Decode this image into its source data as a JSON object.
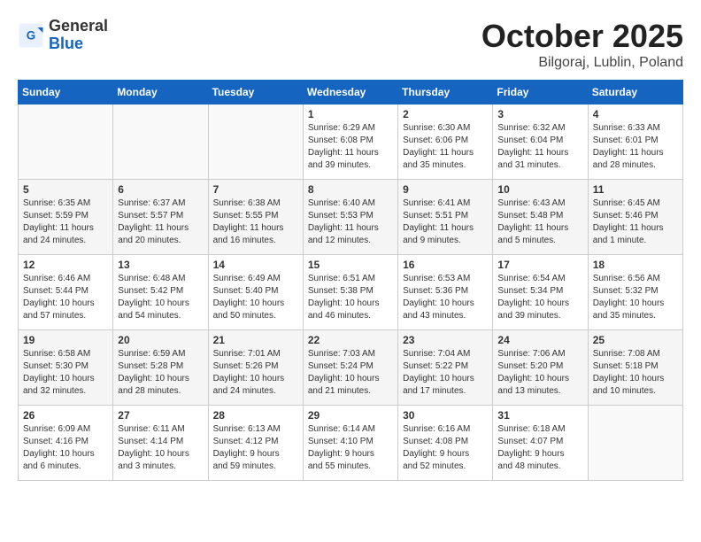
{
  "header": {
    "logo": {
      "general": "General",
      "blue": "Blue"
    },
    "title": "October 2025",
    "location": "Bilgoraj, Lublin, Poland"
  },
  "calendar": {
    "days_of_week": [
      "Sunday",
      "Monday",
      "Tuesday",
      "Wednesday",
      "Thursday",
      "Friday",
      "Saturday"
    ],
    "weeks": [
      [
        {
          "day": "",
          "info": ""
        },
        {
          "day": "",
          "info": ""
        },
        {
          "day": "",
          "info": ""
        },
        {
          "day": "1",
          "info": "Sunrise: 6:29 AM\nSunset: 6:08 PM\nDaylight: 11 hours\nand 39 minutes."
        },
        {
          "day": "2",
          "info": "Sunrise: 6:30 AM\nSunset: 6:06 PM\nDaylight: 11 hours\nand 35 minutes."
        },
        {
          "day": "3",
          "info": "Sunrise: 6:32 AM\nSunset: 6:04 PM\nDaylight: 11 hours\nand 31 minutes."
        },
        {
          "day": "4",
          "info": "Sunrise: 6:33 AM\nSunset: 6:01 PM\nDaylight: 11 hours\nand 28 minutes."
        }
      ],
      [
        {
          "day": "5",
          "info": "Sunrise: 6:35 AM\nSunset: 5:59 PM\nDaylight: 11 hours\nand 24 minutes."
        },
        {
          "day": "6",
          "info": "Sunrise: 6:37 AM\nSunset: 5:57 PM\nDaylight: 11 hours\nand 20 minutes."
        },
        {
          "day": "7",
          "info": "Sunrise: 6:38 AM\nSunset: 5:55 PM\nDaylight: 11 hours\nand 16 minutes."
        },
        {
          "day": "8",
          "info": "Sunrise: 6:40 AM\nSunset: 5:53 PM\nDaylight: 11 hours\nand 12 minutes."
        },
        {
          "day": "9",
          "info": "Sunrise: 6:41 AM\nSunset: 5:51 PM\nDaylight: 11 hours\nand 9 minutes."
        },
        {
          "day": "10",
          "info": "Sunrise: 6:43 AM\nSunset: 5:48 PM\nDaylight: 11 hours\nand 5 minutes."
        },
        {
          "day": "11",
          "info": "Sunrise: 6:45 AM\nSunset: 5:46 PM\nDaylight: 11 hours\nand 1 minute."
        }
      ],
      [
        {
          "day": "12",
          "info": "Sunrise: 6:46 AM\nSunset: 5:44 PM\nDaylight: 10 hours\nand 57 minutes."
        },
        {
          "day": "13",
          "info": "Sunrise: 6:48 AM\nSunset: 5:42 PM\nDaylight: 10 hours\nand 54 minutes."
        },
        {
          "day": "14",
          "info": "Sunrise: 6:49 AM\nSunset: 5:40 PM\nDaylight: 10 hours\nand 50 minutes."
        },
        {
          "day": "15",
          "info": "Sunrise: 6:51 AM\nSunset: 5:38 PM\nDaylight: 10 hours\nand 46 minutes."
        },
        {
          "day": "16",
          "info": "Sunrise: 6:53 AM\nSunset: 5:36 PM\nDaylight: 10 hours\nand 43 minutes."
        },
        {
          "day": "17",
          "info": "Sunrise: 6:54 AM\nSunset: 5:34 PM\nDaylight: 10 hours\nand 39 minutes."
        },
        {
          "day": "18",
          "info": "Sunrise: 6:56 AM\nSunset: 5:32 PM\nDaylight: 10 hours\nand 35 minutes."
        }
      ],
      [
        {
          "day": "19",
          "info": "Sunrise: 6:58 AM\nSunset: 5:30 PM\nDaylight: 10 hours\nand 32 minutes."
        },
        {
          "day": "20",
          "info": "Sunrise: 6:59 AM\nSunset: 5:28 PM\nDaylight: 10 hours\nand 28 minutes."
        },
        {
          "day": "21",
          "info": "Sunrise: 7:01 AM\nSunset: 5:26 PM\nDaylight: 10 hours\nand 24 minutes."
        },
        {
          "day": "22",
          "info": "Sunrise: 7:03 AM\nSunset: 5:24 PM\nDaylight: 10 hours\nand 21 minutes."
        },
        {
          "day": "23",
          "info": "Sunrise: 7:04 AM\nSunset: 5:22 PM\nDaylight: 10 hours\nand 17 minutes."
        },
        {
          "day": "24",
          "info": "Sunrise: 7:06 AM\nSunset: 5:20 PM\nDaylight: 10 hours\nand 13 minutes."
        },
        {
          "day": "25",
          "info": "Sunrise: 7:08 AM\nSunset: 5:18 PM\nDaylight: 10 hours\nand 10 minutes."
        }
      ],
      [
        {
          "day": "26",
          "info": "Sunrise: 6:09 AM\nSunset: 4:16 PM\nDaylight: 10 hours\nand 6 minutes."
        },
        {
          "day": "27",
          "info": "Sunrise: 6:11 AM\nSunset: 4:14 PM\nDaylight: 10 hours\nand 3 minutes."
        },
        {
          "day": "28",
          "info": "Sunrise: 6:13 AM\nSunset: 4:12 PM\nDaylight: 9 hours\nand 59 minutes."
        },
        {
          "day": "29",
          "info": "Sunrise: 6:14 AM\nSunset: 4:10 PM\nDaylight: 9 hours\nand 55 minutes."
        },
        {
          "day": "30",
          "info": "Sunrise: 6:16 AM\nSunset: 4:08 PM\nDaylight: 9 hours\nand 52 minutes."
        },
        {
          "day": "31",
          "info": "Sunrise: 6:18 AM\nSunset: 4:07 PM\nDaylight: 9 hours\nand 48 minutes."
        },
        {
          "day": "",
          "info": ""
        }
      ]
    ]
  }
}
